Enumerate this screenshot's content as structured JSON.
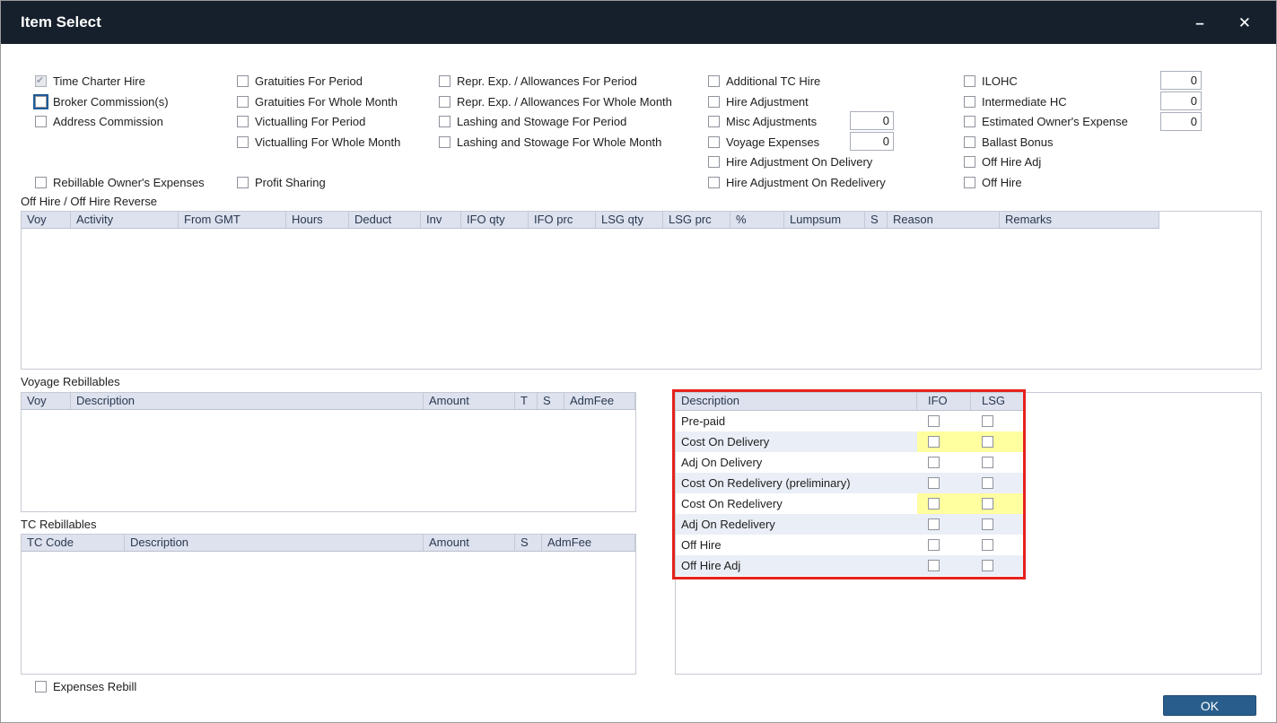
{
  "window": {
    "title": "Item Select",
    "minimize_glyph": "–",
    "close_glyph": "✕"
  },
  "colors": {
    "titlebar_bg": "#16202c",
    "accent_blue": "#295e8c",
    "table_header_bg": "#dde2ee",
    "row_alt": "#eaeef6",
    "highlight_yellow": "#ffffa0",
    "annotation_red": "#e5211c",
    "focus_ring": "#1e5c99"
  },
  "selects": {
    "col1": [
      "Time Charter Hire",
      "Broker Commission(s)",
      "Address Commission",
      "Rebillable Owner's Expenses"
    ],
    "col2": [
      "Gratuities For Period",
      "Gratuities For Whole Month",
      "Victualling For Period",
      "Victualling For Whole Month",
      "Profit Sharing"
    ],
    "col3": [
      "Repr. Exp. / Allowances For Period",
      "Repr. Exp. / Allowances For Whole Month",
      "Lashing and Stowage For Period",
      "Lashing and Stowage For Whole Month"
    ],
    "col4": [
      "Additional TC Hire",
      "Hire Adjustment",
      "Misc Adjustments",
      "Voyage Expenses",
      "Hire Adjustment On Delivery",
      "Hire Adjustment On Redelivery"
    ],
    "col5": [
      "ILOHC",
      "Intermediate HC",
      "Estimated Owner's Expense",
      "Ballast Bonus",
      "Off Hire Adj",
      "Off Hire"
    ]
  },
  "inputs": {
    "misc_adjustments": "0",
    "voyage_expenses": "0",
    "ilohc": "0",
    "intermediate_hc": "0",
    "estimated_owners_expense": "0"
  },
  "off_hire": {
    "label": "Off Hire / Off Hire Reverse",
    "columns": [
      "Voy",
      "Activity",
      "From GMT",
      "Hours",
      "Deduct",
      "Inv",
      "IFO qty",
      "IFO prc",
      "LSG qty",
      "LSG prc",
      "%",
      "Lumpsum",
      "S",
      "Reason",
      "Remarks"
    ]
  },
  "voyage_rebillables": {
    "label": "Voyage Rebillables",
    "columns": [
      "Voy",
      "Description",
      "Amount",
      "T",
      "S",
      "AdmFee"
    ]
  },
  "tc_rebillables": {
    "label": "TC Rebillables",
    "columns": [
      "TC Code",
      "Description",
      "Amount",
      "S",
      "AdmFee"
    ]
  },
  "bunker_select": {
    "columns": [
      "Description",
      "IFO",
      "LSG"
    ],
    "rows": [
      "Pre-paid",
      "Cost On Delivery",
      "Adj On Delivery",
      "Cost On Redelivery (preliminary)",
      "Cost On Redelivery",
      "Adj On Redelivery",
      "Off Hire",
      "Off Hire Adj"
    ]
  },
  "footer": {
    "expenses_rebill_label": "Expenses Rebill",
    "ok_label": "OK"
  }
}
